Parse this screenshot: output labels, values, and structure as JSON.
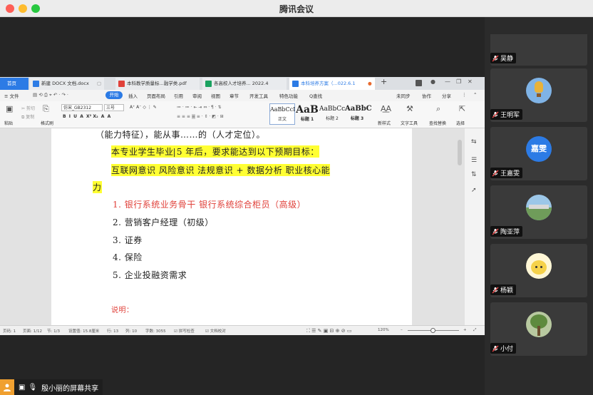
{
  "window": {
    "title": "腾讯会议"
  },
  "wps": {
    "tabs": [
      {
        "label": "首页"
      },
      {
        "label": "新建 DOCX 文档.docx"
      },
      {
        "label": "本科教学质量标...融学类.pdf"
      },
      {
        "label": "各高校人才培养... 2022.4"
      },
      {
        "label": "本科培养方案（...022.6.1"
      }
    ],
    "menu": {
      "file": "≡ 文件",
      "start": "开始",
      "items": [
        "插入",
        "页面布局",
        "引用",
        "审阅",
        "视图",
        "章节",
        "开发工具",
        "特色功能",
        "Q查找"
      ],
      "right": [
        "未同步",
        "协作",
        "分享"
      ]
    },
    "ribbon": {
      "paste": "粘贴",
      "cut": "剪切",
      "copy": "复制",
      "format_painter": "格式刷",
      "font": "仿宋_GB2312",
      "size": "三号",
      "styles": [
        {
          "sample": "AaBbCcI",
          "label": "正文"
        },
        {
          "sample": "AaB",
          "label": "标题 1"
        },
        {
          "sample": "AaBbCc",
          "label": "标题 2"
        },
        {
          "sample": "AaBbC",
          "label": "标题 3"
        }
      ],
      "new_style": "新样式",
      "text_tools": "文字工具",
      "find_replace": "查找替换",
      "select": "选择"
    },
    "document": {
      "line0": "（能力特征），能从事……的（人才定位）。",
      "hl1": "本专业学生毕业 5 年后，要求能达到以下预期目标：",
      "hl2": "互联网意识  风险意识   法规意识 + 数据分析   职业核心能",
      "hl3": "力",
      "items": [
        "1. 银行系统业务骨干  银行系统综合柜员（高级）",
        "2. 营销客户经理（初级）",
        "3. 证券",
        "4. 保险",
        "5. 企业投融资需求"
      ],
      "note": "说明："
    },
    "status": {
      "page": "页码: 1",
      "pages": "页面: 1/12",
      "section": "节: 1/3",
      "setting": "设置值: 15.8厘米",
      "row": "行: 13",
      "col": "列: 10",
      "words": "字数: 3055",
      "spell": "拼写检查",
      "proof": "文档校对",
      "zoom": "120%"
    }
  },
  "presenter": {
    "label": "殷小丽的屏幕共享"
  },
  "participants": [
    {
      "name": "吴静"
    },
    {
      "name": "王明军"
    },
    {
      "name": "王嘉雯",
      "avatar_text": "嘉雯"
    },
    {
      "name": "陶亚萍"
    },
    {
      "name": "杨颖"
    },
    {
      "name": "小付"
    }
  ],
  "colors": {
    "accent": "#2c7be5",
    "highlight": "#ffff33",
    "red_text": "#e0413a"
  }
}
